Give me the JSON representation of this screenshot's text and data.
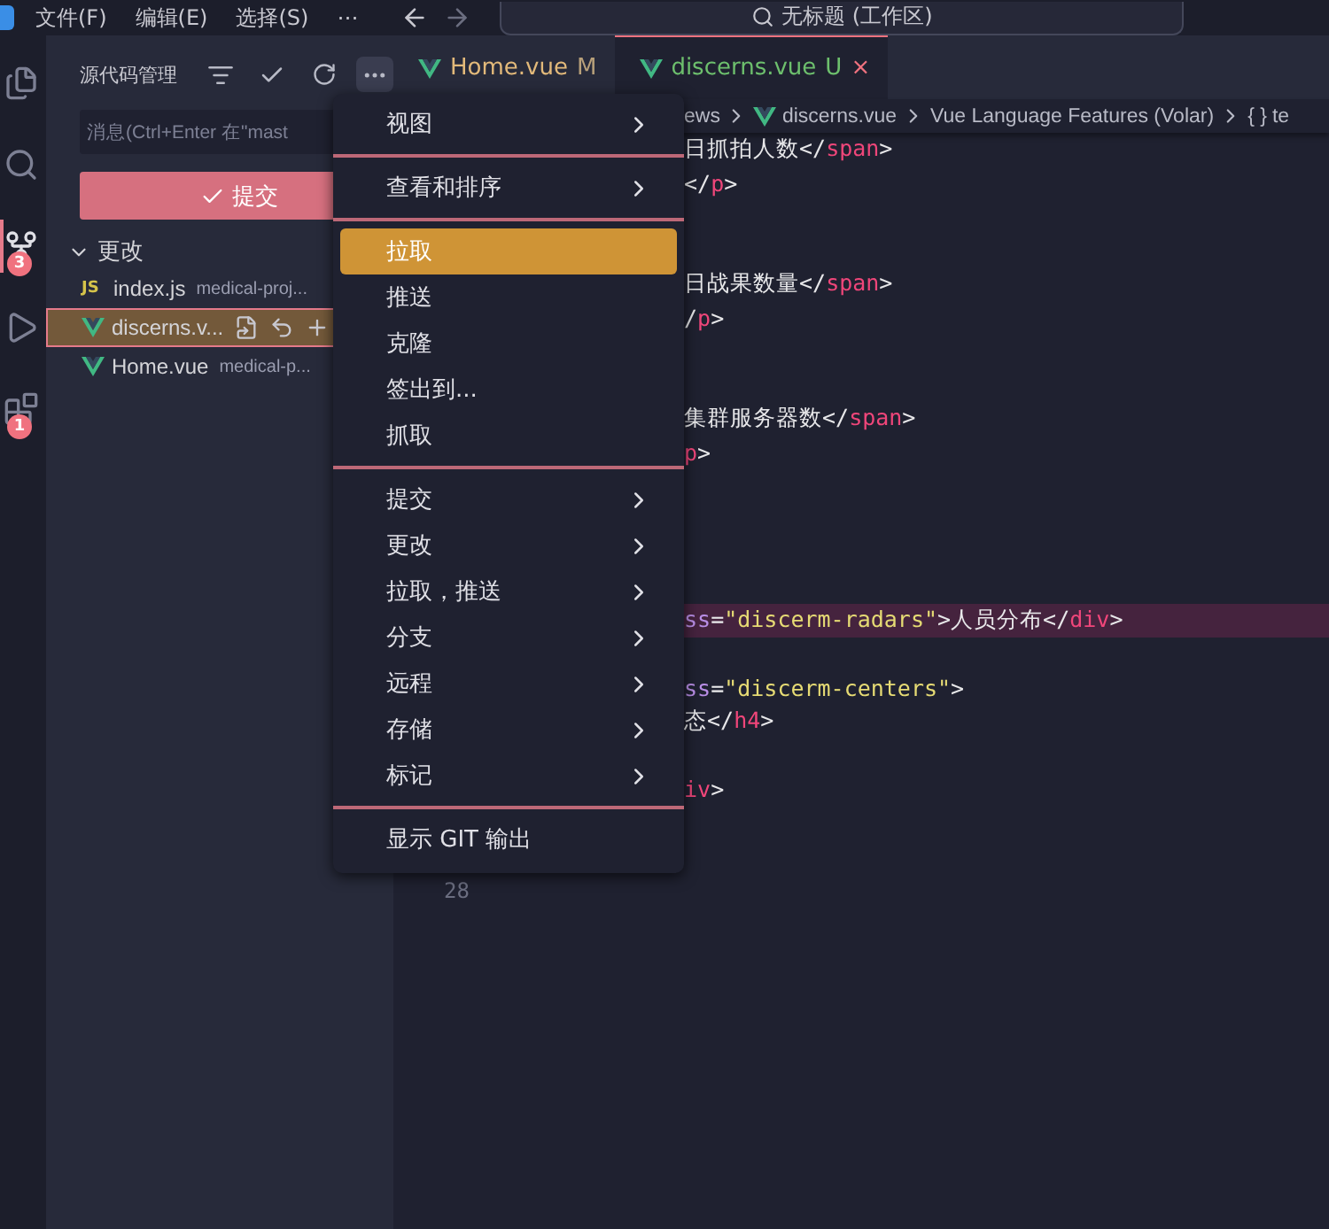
{
  "menubar": {
    "items": [
      "文件(F)",
      "编辑(E)",
      "选择(S)",
      "⋯"
    ],
    "search": "无标题 (工作区)"
  },
  "activity_bar": [
    {
      "kind": "files",
      "selected": false
    },
    {
      "kind": "search",
      "selected": false
    },
    {
      "kind": "source-control",
      "selected": true,
      "badge": "3"
    },
    {
      "kind": "run",
      "selected": false
    },
    {
      "kind": "extensions",
      "selected": false,
      "badge": "1"
    }
  ],
  "sidebar": {
    "title": "源代码管理",
    "message": {
      "placeholder": "消息(Ctrl+Enter 在\"mast"
    },
    "commit_button": "提交",
    "group": {
      "label": "更改",
      "expanded": true
    },
    "files": [
      {
        "kind": "js",
        "badge": "JS",
        "name": "index.js",
        "path": "medical-proj...",
        "selected": false
      },
      {
        "kind": "vue",
        "name": "discerns.v...",
        "selected": true
      },
      {
        "kind": "vue",
        "name": "Home.vue",
        "path": "medical-p...",
        "selected": false
      }
    ]
  },
  "tabs": [
    {
      "name": "Home.vue",
      "status": "M",
      "selected": false
    },
    {
      "name": "discerns.vue",
      "status": "U",
      "selected": true,
      "close": "×"
    }
  ],
  "breadcrumbs": [
    "ews",
    "discerns.vue",
    "Vue Language Features (Volar)",
    "{ }",
    "te"
  ],
  "editor": {
    "lines": [
      {
        "highlighted": false,
        "segments": [
          {
            "text": "日抓拍人数",
            "kind": "text"
          },
          {
            "text": "</",
            "kind": "punct"
          },
          {
            "text": "span",
            "kind": "tag"
          },
          {
            "text": ">",
            "kind": "punct"
          }
        ]
      },
      {
        "highlighted": false,
        "segments": [
          {
            "text": "</",
            "kind": "punct"
          },
          {
            "text": "p",
            "kind": "tag"
          },
          {
            "text": ">",
            "kind": "punct"
          }
        ]
      },
      {
        "highlighted": false
      },
      {
        "highlighted": false
      },
      {
        "highlighted": false,
        "segments": [
          {
            "text": "日战果数量",
            "kind": "text"
          },
          {
            "text": "</",
            "kind": "punct"
          },
          {
            "text": "span",
            "kind": "tag"
          },
          {
            "text": ">",
            "kind": "punct"
          }
        ]
      },
      {
        "highlighted": false,
        "segments": [
          {
            "text": "/",
            "kind": "punct"
          },
          {
            "text": "p",
            "kind": "tag"
          },
          {
            "text": ">",
            "kind": "punct"
          }
        ]
      },
      {
        "highlighted": false
      },
      {
        "highlighted": false
      },
      {
        "highlighted": false,
        "segments": [
          {
            "text": "集群服务器数",
            "kind": "text"
          },
          {
            "text": "</",
            "kind": "punct"
          },
          {
            "text": "span",
            "kind": "tag"
          },
          {
            "text": ">",
            "kind": "punct"
          }
        ]
      },
      {
        "highlighted": false,
        "segments": [
          {
            "text": "p",
            "kind": "tag"
          },
          {
            "text": ">",
            "kind": "punct"
          }
        ]
      },
      {
        "highlighted": false
      },
      {
        "highlighted": false
      },
      {
        "highlighted": false
      },
      {
        "highlighted": false
      },
      {
        "highlighted": true,
        "segments": [
          {
            "text": "ss",
            "kind": "attr"
          },
          {
            "text": "=",
            "kind": "punct"
          },
          {
            "text": "\"discerm-radars\"",
            "kind": "string"
          },
          {
            "text": ">人员分布",
            "kind": "text"
          },
          {
            "text": "</",
            "kind": "punct"
          },
          {
            "text": "div",
            "kind": "tag"
          },
          {
            "text": ">",
            "kind": "punct"
          }
        ]
      },
      {
        "highlighted": false
      },
      {
        "highlighted": false,
        "segments": [
          {
            "text": "ss",
            "kind": "attr"
          },
          {
            "text": "=",
            "kind": "punct"
          },
          {
            "text": "\"discerm-centers\"",
            "kind": "string"
          },
          {
            "text": ">",
            "kind": "punct"
          }
        ]
      },
      {
        "highlighted": false,
        "segments": [
          {
            "text": "态",
            "kind": "text"
          },
          {
            "text": "</",
            "kind": "punct"
          },
          {
            "text": "h4",
            "kind": "tag"
          },
          {
            "text": ">",
            "kind": "punct"
          }
        ]
      },
      {
        "highlighted": false
      },
      {
        "highlighted": false,
        "segments": [
          {
            "text": "iv",
            "kind": "tag"
          },
          {
            "text": ">",
            "kind": "punct"
          }
        ]
      },
      {
        "highlighted": false
      },
      {
        "highlighted": false
      },
      {
        "highlighted": false,
        "number": "28"
      }
    ]
  },
  "context_menu": {
    "groups": [
      [
        {
          "label": "视图",
          "submenu": true,
          "selected": false
        }
      ],
      [
        {
          "label": "查看和排序",
          "submenu": true,
          "selected": false
        }
      ],
      [
        {
          "label": "拉取",
          "submenu": false,
          "selected": true
        },
        {
          "label": "推送",
          "submenu": false,
          "selected": false
        },
        {
          "label": "克隆",
          "submenu": false,
          "selected": false
        },
        {
          "label": "签出到...",
          "submenu": false,
          "selected": false
        },
        {
          "label": "抓取",
          "submenu": false,
          "selected": false
        }
      ],
      [
        {
          "label": "提交",
          "submenu": true,
          "selected": false
        },
        {
          "label": "更改",
          "submenu": true,
          "selected": false
        },
        {
          "label": "拉取，推送",
          "submenu": true,
          "selected": false
        },
        {
          "label": "分支",
          "submenu": true,
          "selected": false
        },
        {
          "label": "远程",
          "submenu": true,
          "selected": false
        },
        {
          "label": "存储",
          "submenu": true,
          "selected": false
        },
        {
          "label": "标记",
          "submenu": true,
          "selected": false
        }
      ],
      [
        {
          "label": "显示 GIT 输出",
          "submenu": false,
          "selected": false
        }
      ]
    ]
  }
}
